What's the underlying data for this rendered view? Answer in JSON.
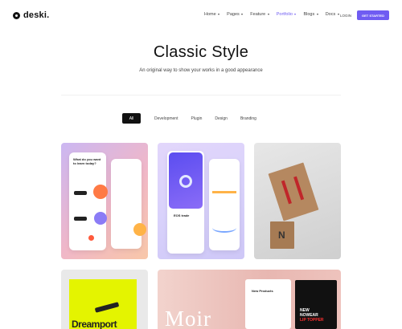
{
  "brand": {
    "name": "deski."
  },
  "nav": {
    "items": [
      {
        "label": "Home",
        "active": false
      },
      {
        "label": "Pages",
        "active": false
      },
      {
        "label": "Feature",
        "active": false
      },
      {
        "label": "Portfolio",
        "active": true
      },
      {
        "label": "Blogs",
        "active": false
      },
      {
        "label": "Docs",
        "active": false
      }
    ],
    "login_label": "LOGIN",
    "cta_label": "GET STARTED"
  },
  "hero": {
    "title": "Classic Style",
    "subtitle": "An original way to show your works in a good appearance"
  },
  "filters": {
    "items": [
      "All",
      "Development",
      "Plugin",
      "Design",
      "Branding"
    ],
    "selected": "All"
  },
  "portfolio": {
    "card1": {
      "question": "What do you want to learn today?"
    },
    "card2": {
      "label": "EOS trade"
    },
    "card4": {
      "text": "Dreamport"
    },
    "card5": {
      "brand": "Moir",
      "shop_title": "New Products",
      "promo": [
        "NEW",
        "NOWEAR",
        "LIP TOPPER"
      ]
    }
  },
  "colors": {
    "accent": "#6f5cf2",
    "filter_active_bg": "#111111"
  }
}
